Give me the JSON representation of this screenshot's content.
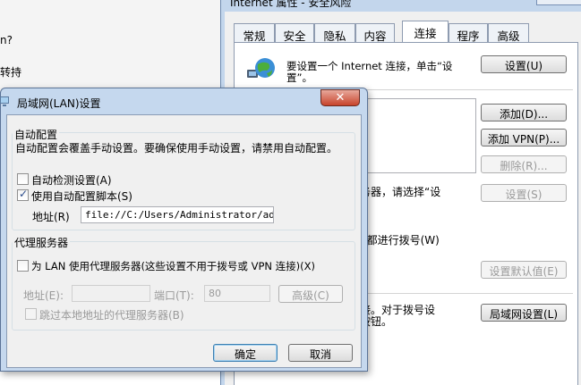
{
  "background_window": {
    "line1": "n?",
    "line2": "转持"
  },
  "ie_window": {
    "title": "Internet 属性 - 安全风险",
    "tabs": [
      {
        "label": "常规"
      },
      {
        "label": "安全"
      },
      {
        "label": "隐私"
      },
      {
        "label": "内容"
      },
      {
        "label": "连接",
        "active": true
      },
      {
        "label": "程序"
      },
      {
        "label": "高级"
      }
    ],
    "setup_text_line1": "要设置一个 Internet 连接，单击“设",
    "setup_text_line2": "置”。",
    "setup_button": "设置(U)",
    "add_button": "添加(D)...",
    "add_vpn_button": "添加 VPN(P)...",
    "delete_button": "删除(R)...",
    "settings_button": "设置(S)",
    "proxy_text": "务器，请选择“设",
    "dial_text": "E都进行拨号(W)",
    "set_default_button": "设置默认值(E)",
    "lan_text_line1": "接。对于拨号设",
    "lan_text_line2": "按钮。",
    "lan_settings_button": "局域网设置(L)"
  },
  "lan_dialog": {
    "title": "局域网(LAN)设置",
    "close_glyph": "✕",
    "auto_config": {
      "group_label": "自动配置",
      "description": "自动配置会覆盖手动设置。要确保使用手动设置，请禁用自动配置。",
      "auto_detect_label": "自动检测设置(A)",
      "auto_detect_checked": false,
      "use_script_label": "使用自动配置脚本(S)",
      "use_script_checked": true,
      "address_label": "地址(R)",
      "address_value": "file://C:/Users/Administrator/admpo"
    },
    "proxy": {
      "group_label": "代理服务器",
      "use_proxy_label": "为 LAN 使用代理服务器(这些设置不用于拨号或 VPN 连接)(X)",
      "use_proxy_checked": false,
      "address_label": "地址(E):",
      "address_value": "",
      "port_label": "端口(T):",
      "port_value": "80",
      "advanced_button": "高级(C)",
      "bypass_label": "跳过本地地址的代理服务器(B)",
      "bypass_checked": false
    },
    "ok_button": "确定",
    "cancel_button": "取消"
  }
}
